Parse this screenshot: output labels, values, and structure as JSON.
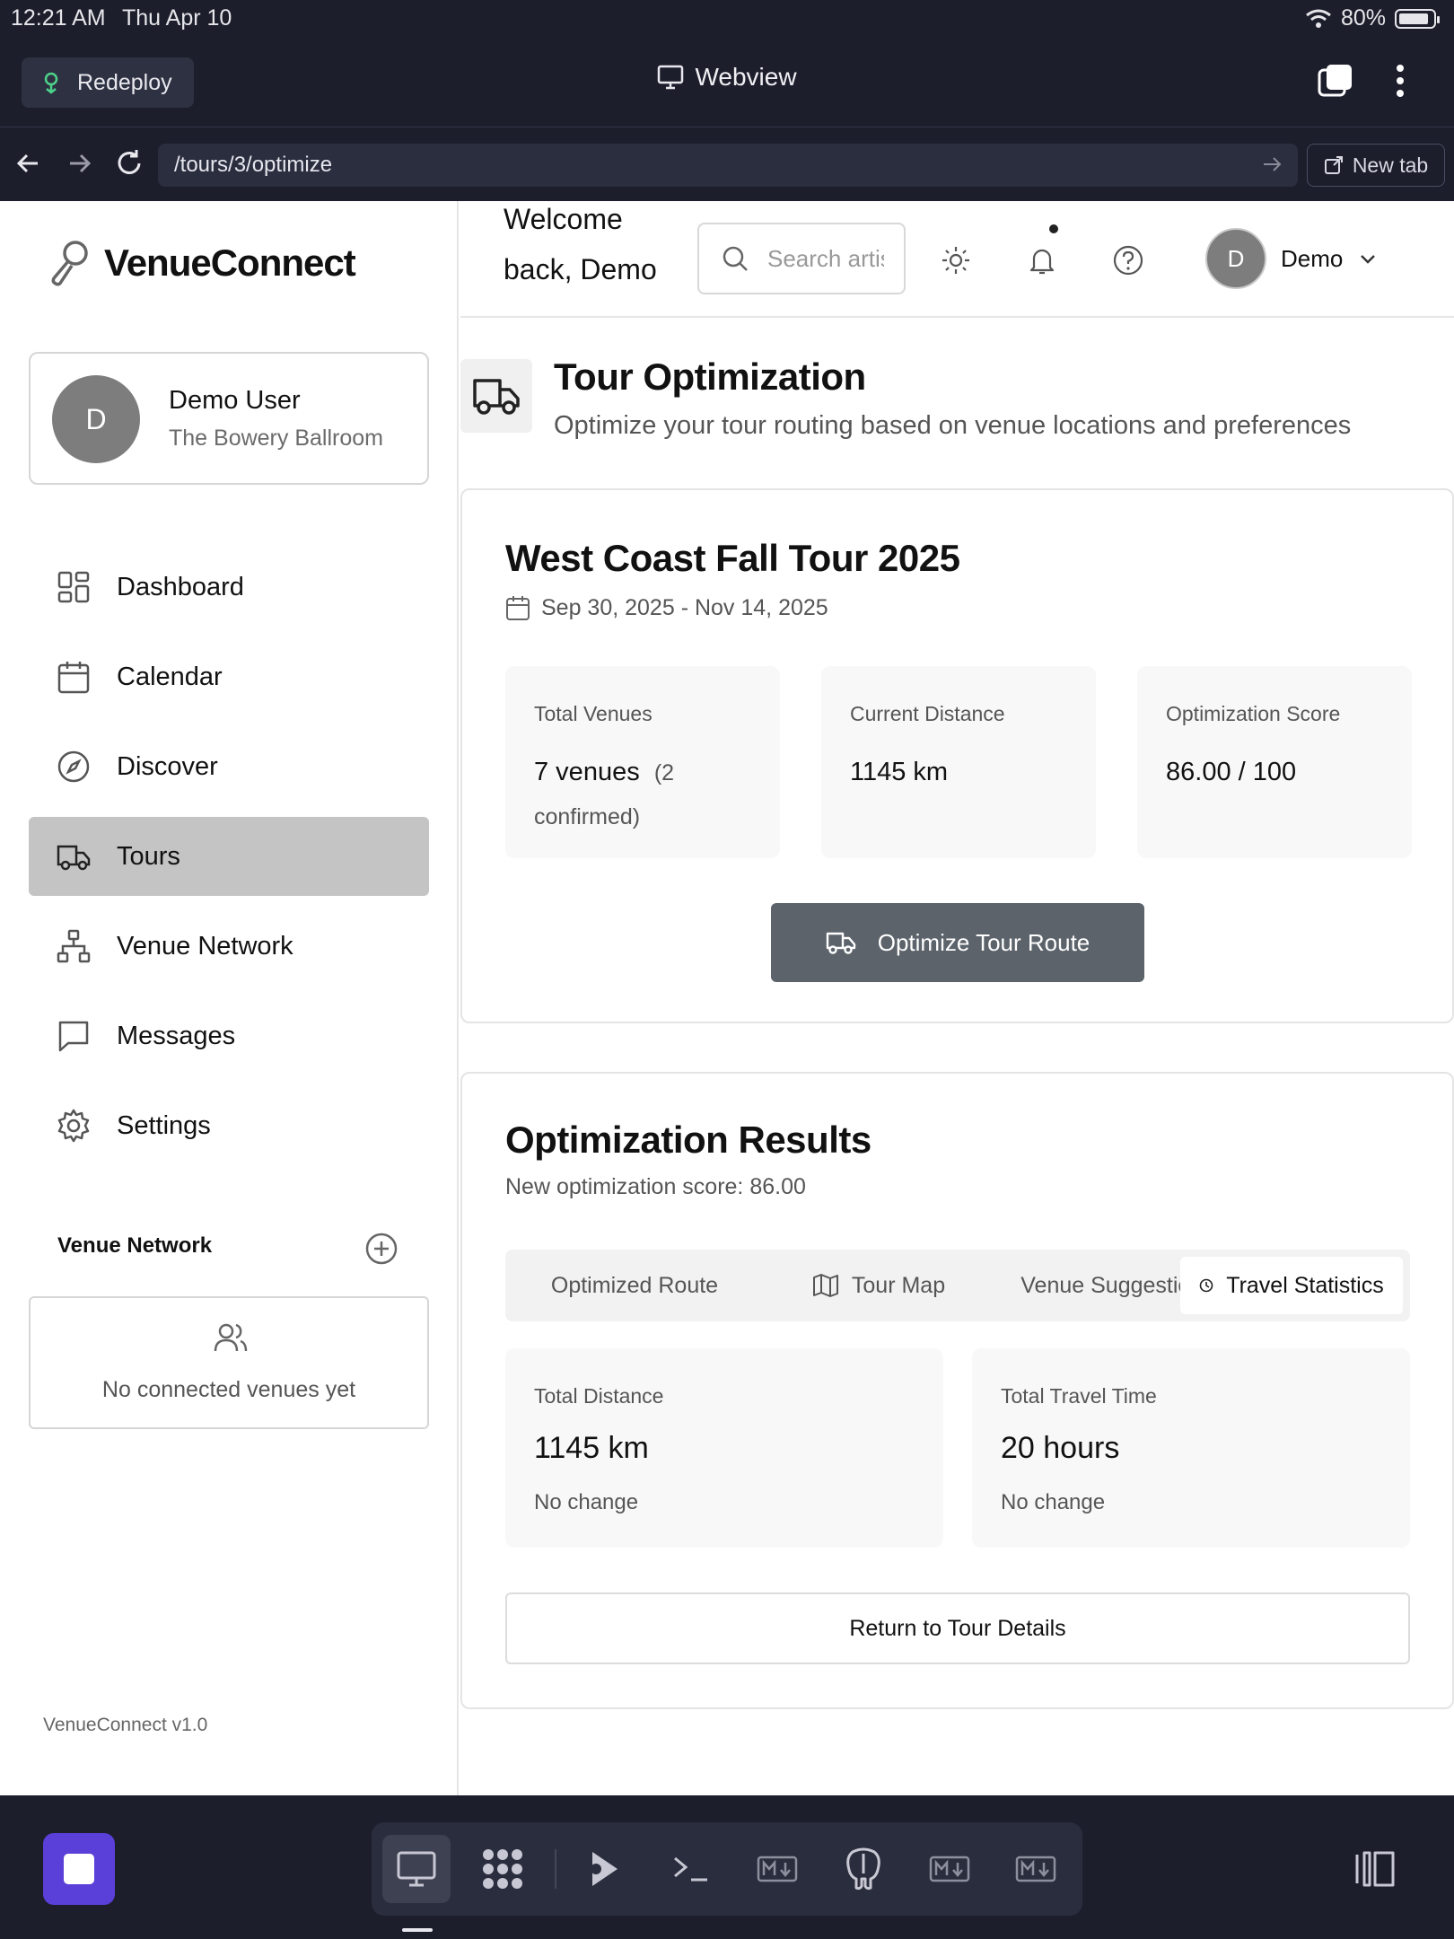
{
  "status": {
    "time": "12:21 AM",
    "date": "Thu Apr 10",
    "battery": "80%"
  },
  "toolbar": {
    "redeploy_label": "Redeploy",
    "webview_label": "Webview"
  },
  "browser": {
    "url": "/tours/3/optimize",
    "new_tab_label": "New tab"
  },
  "sidebar": {
    "brand": "VenueConnect",
    "user": {
      "initial": "D",
      "name": "Demo User",
      "venue": "The Bowery Ballroom"
    },
    "nav": [
      {
        "label": "Dashboard",
        "icon": "grid-icon"
      },
      {
        "label": "Calendar",
        "icon": "calendar-icon"
      },
      {
        "label": "Discover",
        "icon": "compass-icon"
      },
      {
        "label": "Tours",
        "icon": "truck-icon",
        "active": true
      },
      {
        "label": "Venue Network",
        "icon": "network-icon"
      },
      {
        "label": "Messages",
        "icon": "message-icon"
      },
      {
        "label": "Settings",
        "icon": "gear-icon"
      }
    ],
    "venue_network": {
      "title": "Venue Network",
      "empty_text": "No connected venues yet"
    },
    "version": "VenueConnect v1.0"
  },
  "header": {
    "welcome": "Welcome back, Demo",
    "search_placeholder": "Search artists, venues...",
    "user_initial": "D",
    "user_name": "Demo"
  },
  "page": {
    "title": "Tour Optimization",
    "subtitle": "Optimize your tour routing based on venue locations and preferences"
  },
  "tour": {
    "name": "West Coast Fall Tour 2025",
    "dates": "Sep 30, 2025 - Nov 14, 2025",
    "stats": [
      {
        "label": "Total Venues",
        "value": "7 venues",
        "extra": "(2 confirmed)"
      },
      {
        "label": "Current Distance",
        "value": "1145 km",
        "extra": ""
      },
      {
        "label": "Optimization Score",
        "value": "86.00 / 100",
        "extra": ""
      }
    ],
    "optimize_label": "Optimize Tour Route"
  },
  "results": {
    "title": "Optimization Results",
    "score_text": "New optimization score: 86.00",
    "tabs": [
      "Optimized Route",
      "Tour Map",
      "Venue Suggestions",
      "Travel Statistics"
    ],
    "active_tab": "Travel Statistics",
    "stats": [
      {
        "label": "Total Distance",
        "value": "1145 km",
        "note": "No change"
      },
      {
        "label": "Total Travel Time",
        "value": "20 hours",
        "note": "No change"
      }
    ],
    "return_label": "Return to Tour Details"
  },
  "colors": {
    "chrome_bg": "#1c1e2c",
    "active_nav": "#c4c4c4",
    "primary_button": "#5c636b",
    "stop_button": "#5b3fd9"
  }
}
